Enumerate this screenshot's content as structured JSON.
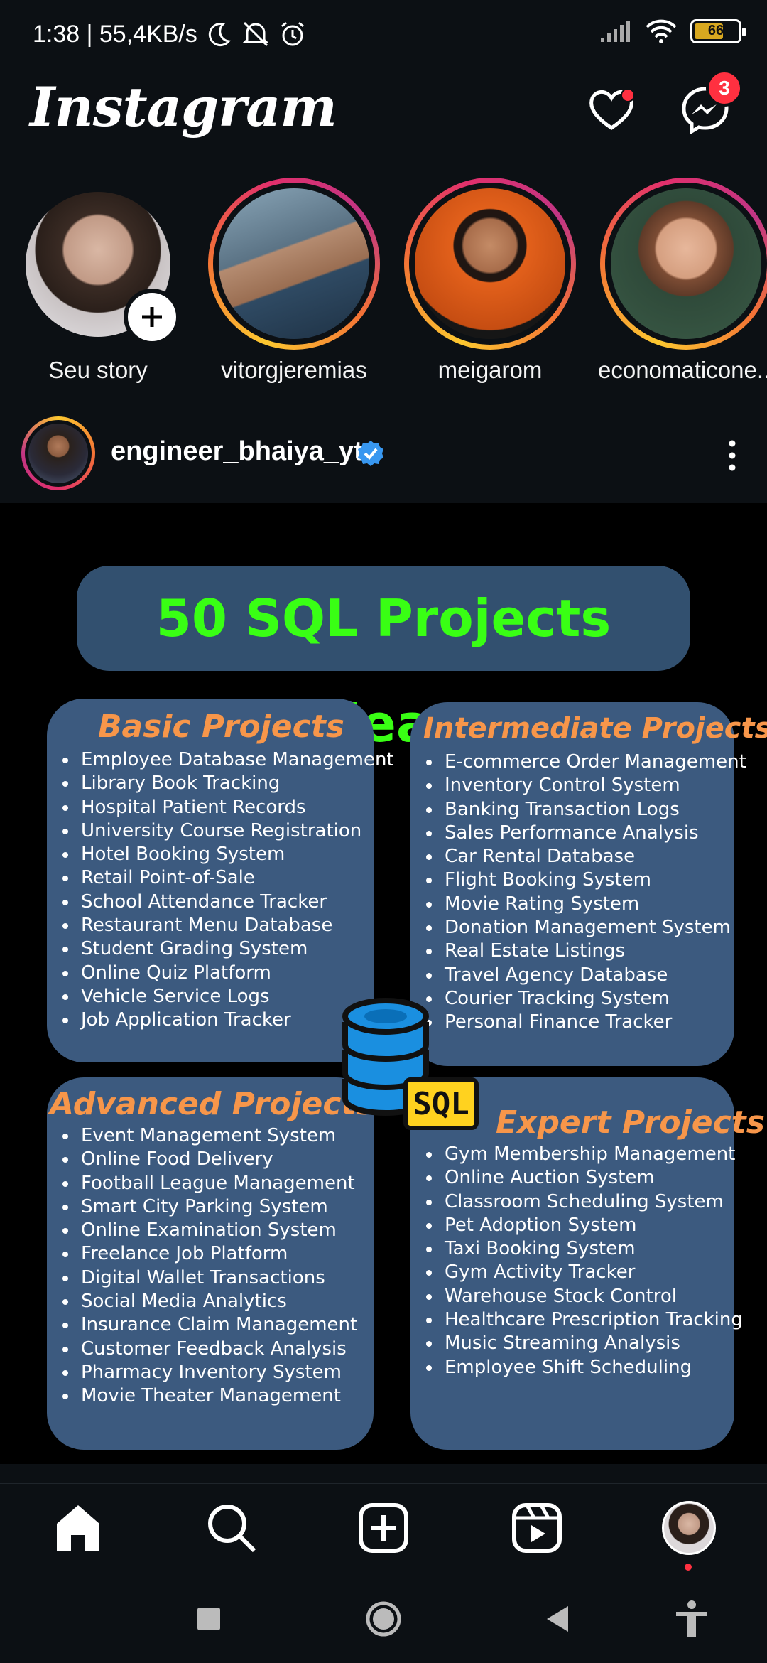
{
  "status_bar": {
    "time_and_speed": "1:38 | 55,4KB/s",
    "battery": "66"
  },
  "header": {
    "logo": "Instagram",
    "messages_badge": "3"
  },
  "stories": [
    {
      "label": "Seu story"
    },
    {
      "label": "vitorgjeremias"
    },
    {
      "label": "meigarom"
    },
    {
      "label": "economaticone..."
    }
  ],
  "post": {
    "username": "engineer_bhaiya_yt",
    "image": {
      "title": "50 SQL Projects Ideas",
      "sql_badge": "SQL",
      "sections": [
        {
          "heading": "Basic Projects",
          "items": [
            "Employee Database Management",
            "Library Book Tracking",
            "Hospital Patient Records",
            "University Course Registration",
            "Hotel Booking System",
            "Retail Point-of-Sale",
            "School Attendance Tracker",
            "Restaurant Menu Database",
            "Student Grading System",
            "Online Quiz Platform",
            "Vehicle Service Logs",
            "Job Application Tracker"
          ]
        },
        {
          "heading": "Intermediate  Projects",
          "items": [
            "E-commerce Order Management",
            "Inventory Control System",
            "Banking Transaction Logs",
            "Sales Performance Analysis",
            "Car Rental Database",
            "Flight Booking System",
            "Movie Rating System",
            "Donation Management System",
            "Real Estate Listings",
            "Travel Agency Database",
            "Courier Tracking System",
            "Personal Finance Tracker"
          ]
        },
        {
          "heading": "Advanced Projects",
          "items": [
            "Event Management System",
            "Online Food Delivery",
            "Football League Management",
            "Smart City Parking System",
            "Online Examination System",
            "Freelance Job Platform",
            "Digital Wallet Transactions",
            "Social Media Analytics",
            "Insurance Claim Management",
            "Customer Feedback Analysis",
            "Pharmacy Inventory System",
            "Movie Theater Management"
          ]
        },
        {
          "heading": "Expert Projects",
          "items": [
            "Gym Membership Management",
            "Online Auction System",
            "Classroom Scheduling System",
            "Pet Adoption System",
            "Taxi Booking System",
            "Gym Activity Tracker",
            "Warehouse Stock Control",
            "Healthcare Prescription Tracking",
            "Music Streaming Analysis",
            "Employee Shift Scheduling"
          ]
        }
      ]
    }
  },
  "nav": {
    "items": [
      "home-icon",
      "search-icon",
      "create-icon",
      "reels-icon",
      "profile-avatar"
    ]
  },
  "colors": {
    "background": "#0c1014",
    "title_green": "#39ff14",
    "card_blue": "#3c5a7f",
    "heading_orange": "#f7964a",
    "notification_red": "#ff3040"
  }
}
